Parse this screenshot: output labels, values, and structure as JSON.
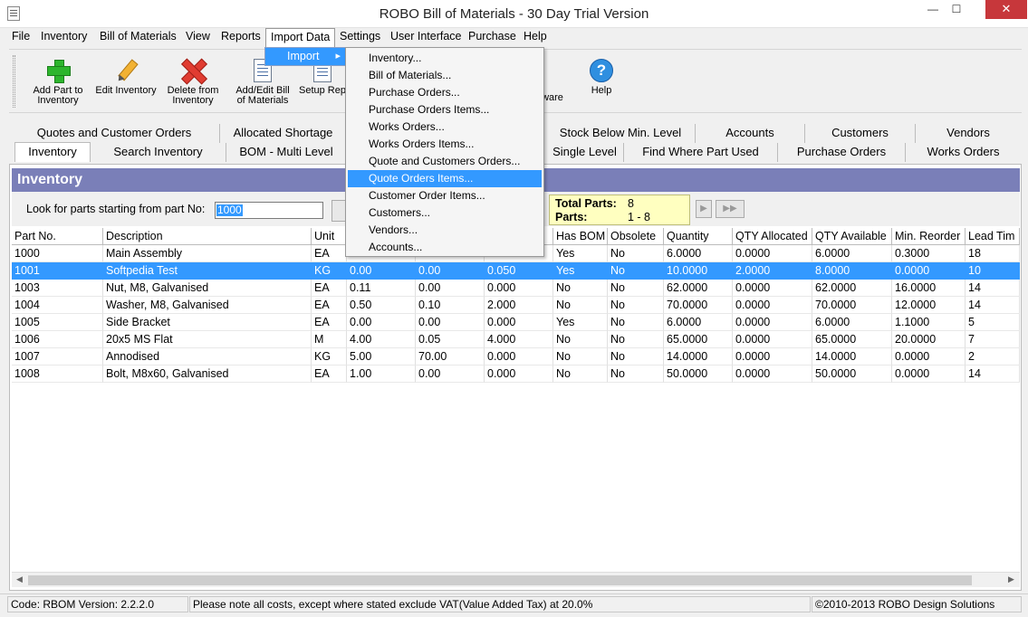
{
  "window": {
    "title": "ROBO Bill of Materials - 30 Day Trial Version",
    "min": "—",
    "max": "☐",
    "close": "✕"
  },
  "menubar": {
    "items": [
      "File",
      "Inventory",
      "Bill of Materials",
      "View",
      "Reports",
      "Import Data",
      "Settings",
      "User Interface",
      "Purchase",
      "Help"
    ]
  },
  "toolbar": {
    "add_part": "Add Part to Inventory",
    "edit_inventory": "Edit Inventory",
    "delete_inventory": "Delete from Inventory",
    "add_edit_bom": "Add/Edit Bill of Materials",
    "setup_rep": "Setup Rep",
    "ware": "ware",
    "help": "Help"
  },
  "tabs": {
    "row1": [
      "Quotes and Customer Orders",
      "Allocated Shortage",
      "Stock Below Min. Level",
      "Accounts",
      "Customers",
      "Vendors"
    ],
    "row2": [
      "Inventory",
      "Search Inventory",
      "BOM - Multi Level",
      "Single Level",
      "Find Where Part Used",
      "Purchase Orders",
      "Works Orders"
    ]
  },
  "panel": {
    "title": "Inventory",
    "look_label": "Look for parts starting from part No:",
    "look_value": "1000",
    "total_parts_label": "Total Parts:",
    "total_parts_value": "8",
    "parts_label": "Parts:",
    "parts_value": "1 - 8",
    "nav_next": "▶",
    "nav_last": "▶▶"
  },
  "grid": {
    "columns": [
      "Part No.",
      "Description",
      "Unit",
      "",
      "",
      "",
      "Has BOM",
      "Obsolete",
      "Quantity",
      "QTY Allocated",
      "QTY Available",
      "Min. Reorder",
      "Lead Tim"
    ],
    "rows": [
      [
        "1000",
        "Main Assembly",
        "EA",
        "",
        "",
        "",
        "Yes",
        "No",
        "6.0000",
        "0.0000",
        "6.0000",
        "0.3000",
        "18"
      ],
      [
        "1001",
        "Softpedia Test",
        "KG",
        "0.00",
        "0.00",
        "0.050",
        "Yes",
        "No",
        "10.0000",
        "2.0000",
        "8.0000",
        "0.0000",
        "10"
      ],
      [
        "1003",
        "Nut, M8, Galvanised",
        "EA",
        "0.11",
        "0.00",
        "0.000",
        "No",
        "No",
        "62.0000",
        "0.0000",
        "62.0000",
        "16.0000",
        "14"
      ],
      [
        "1004",
        "Washer, M8, Galvanised",
        "EA",
        "0.50",
        "0.10",
        "2.000",
        "No",
        "No",
        "70.0000",
        "0.0000",
        "70.0000",
        "12.0000",
        "14"
      ],
      [
        "1005",
        "Side Bracket",
        "EA",
        "0.00",
        "0.00",
        "0.000",
        "Yes",
        "No",
        "6.0000",
        "0.0000",
        "6.0000",
        "1.1000",
        "5"
      ],
      [
        "1006",
        "20x5 MS Flat",
        "M",
        "4.00",
        "0.05",
        "4.000",
        "No",
        "No",
        "65.0000",
        "0.0000",
        "65.0000",
        "20.0000",
        "7"
      ],
      [
        "1007",
        "Annodised",
        "KG",
        "5.00",
        "70.00",
        "0.000",
        "No",
        "No",
        "14.0000",
        "0.0000",
        "14.0000",
        "0.0000",
        "2"
      ],
      [
        "1008",
        "Bolt, M8x60, Galvanised",
        "EA",
        "1.00",
        "0.00",
        "0.000",
        "No",
        "No",
        "50.0000",
        "0.0000",
        "50.0000",
        "0.0000",
        "14"
      ]
    ],
    "selected_row": 1
  },
  "status": {
    "version": "Code: RBOM Version: 2.2.2.0",
    "note": "Please note all costs, except where stated exclude VAT(Value Added Tax) at 20.0%",
    "copyright": "©2010-2013 ROBO Design Solutions"
  },
  "import_menu": {
    "label": "Import",
    "items": [
      "Inventory...",
      "Bill of Materials...",
      "Purchase Orders...",
      "Purchase Orders Items...",
      "Works Orders...",
      "Works Orders Items...",
      "Quote and Customers Orders...",
      "Quote Orders Items...",
      "Customer Order Items...",
      "Customers...",
      "Vendors...",
      "Accounts..."
    ],
    "highlighted": 7
  },
  "colors": {
    "accent": "#3399ff",
    "panel_header": "#7a7fb8",
    "close_button": "#c7373b",
    "totals_bg": "#ffffc0"
  }
}
